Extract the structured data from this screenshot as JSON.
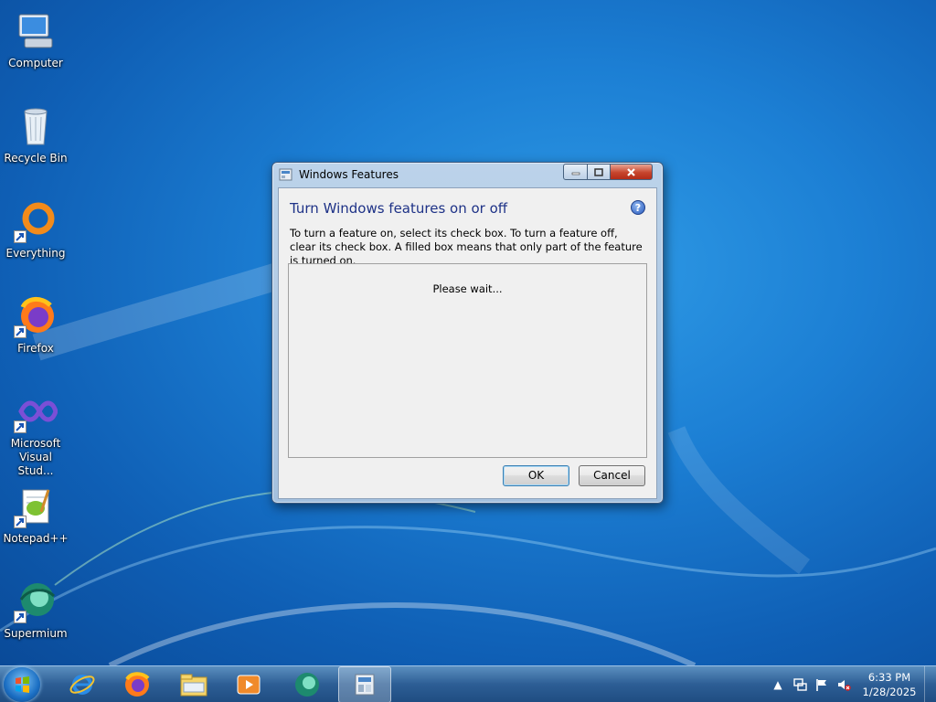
{
  "desktop": {
    "icons": [
      {
        "label": "Computer",
        "icon": "computer-icon"
      },
      {
        "label": "Recycle Bin",
        "icon": "recycle-bin-icon"
      },
      {
        "label": "Everything",
        "icon": "everything-icon"
      },
      {
        "label": "Firefox",
        "icon": "firefox-icon"
      },
      {
        "label": "Microsoft Visual Stud...",
        "icon": "visual-studio-icon"
      },
      {
        "label": "Notepad++",
        "icon": "notepad-plus-plus-icon"
      },
      {
        "label": "Supermium",
        "icon": "supermium-icon"
      }
    ]
  },
  "window": {
    "title": "Windows Features",
    "heading": "Turn Windows features on or off",
    "description": "To turn a feature on, select its check box. To turn a feature off, clear its check box. A filled box means that only part of the feature is turned on.",
    "status": "Please wait...",
    "ok_label": "OK",
    "cancel_label": "Cancel",
    "help_glyph": "?"
  },
  "taskbar": {
    "items": [
      "internet-explorer-icon",
      "firefox-icon",
      "file-explorer-icon",
      "media-player-icon",
      "supermium-icon",
      "windows-features-icon"
    ],
    "tray": {
      "expand_glyph": "▲",
      "time": "6:33 PM",
      "date": "1/28/2025"
    }
  },
  "colors": {
    "heading": "#1e3287",
    "desktop_blue": "#1c7fd4"
  }
}
